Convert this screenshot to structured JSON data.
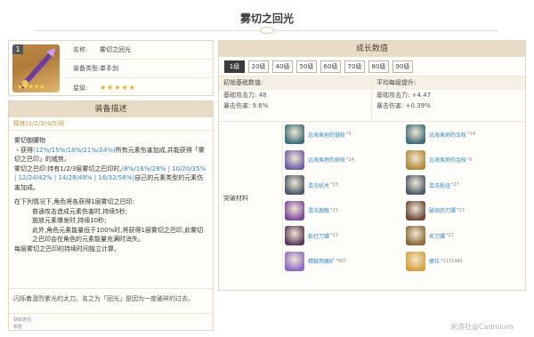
{
  "page": {
    "title": "雾切之回光"
  },
  "info": {
    "rank_badge": "1",
    "rows": [
      {
        "label": "名称:",
        "value": "雾切之回光"
      },
      {
        "label": "装备类型:",
        "value": "单手剑"
      },
      {
        "label": "星级:",
        "value": "★★★★★"
      }
    ],
    "image_stars": "★★★★★"
  },
  "description": {
    "header": "装备描述",
    "refine": "精炼(1/2/3/4/5)阶",
    "lines": [
      "雾切御腰物",
      "・获得",
      "(12%/15%/18%/21%/24%)",
      "所有元素伤害加成,并能获得「雾切之巴印」的威势。",
      "雾切之巴印:持有1/2/3层雾切之巴印时,",
      "(8%/16%/28% | 10/20/35% | 12/24/42% | 14/28/49% | 16/32/56%)",
      "自己的元素类型的元素伤害加成。",
      "在下列情况下,角色将各获得1层雾切之巴印:",
      "普通攻击造成元素伤害时,持续5秒;",
      "施放元素爆发时,持续10秒;",
      "此外,角色元素能量低于100%时,将获得1层雾切之巴印,此雾切之巴印会在角色的元素能量充满时消失。",
      "每层雾切之巴印的持续时间独立计算。"
    ],
    "story": "闪烁着澄烈紫光的太刀。名之为「回光」是因为一度破碎的过去。",
    "source_label": "获取途径:",
    "source_value": "祈愿"
  },
  "growth": {
    "header": "成长数值",
    "levels": [
      "1级",
      "20级",
      "40级",
      "50级",
      "60级",
      "70级",
      "80级",
      "90级"
    ],
    "active_level": "1级",
    "base_head": "初始基础数值:",
    "avg_head": "平均每级提升:",
    "base_lines": [
      "基础攻击力: 48",
      "暴击伤害: 9.6%"
    ],
    "avg_lines": [
      "基础攻击力: +4.47",
      "暴击伤害: +0.39%"
    ],
    "materials_label": "突破材料",
    "materials": [
      {
        "name": "远海夷地的瑚枝",
        "count": "*5",
        "color": "#3d6f7a"
      },
      {
        "name": "远海夷地的玉枝",
        "count": "*14",
        "color": "#3d6f7a"
      },
      {
        "name": "远海夷地的琼枝",
        "count": "*14",
        "color": "#6a5fa8"
      },
      {
        "name": "远海夷地的金枝",
        "count": "*6",
        "color": "#b08a3a"
      },
      {
        "name": "混沌机关",
        "count": "*23",
        "color": "#4b5a6a"
      },
      {
        "name": "混沌枢纽",
        "count": "*27",
        "color": "#4b5a6a"
      },
      {
        "name": "混沌真眼",
        "count": "*23",
        "color": "#7a4a9a"
      },
      {
        "name": "破旧的刀镡",
        "count": "*23",
        "color": "#6a4a3a"
      },
      {
        "name": "影打刀镡",
        "count": "*23",
        "color": "#5a3a5a"
      },
      {
        "name": "名刀镡",
        "count": "*27",
        "color": "#8a6a3a"
      },
      {
        "name": "精锻用魔矿",
        "count": "*907",
        "color": "#8a6ac8"
      },
      {
        "name": "摩拉",
        "count": "*1131445",
        "color": "#d4a03a"
      }
    ]
  },
  "watermark": "米游社@Cadmium"
}
